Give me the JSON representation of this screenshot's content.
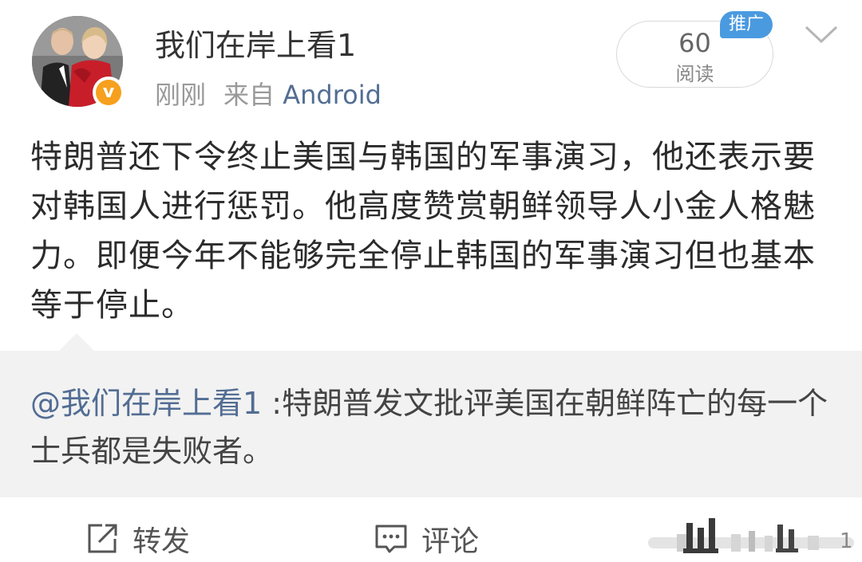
{
  "post": {
    "author": "我们在岸上看1",
    "time": "刚刚",
    "source_prefix": "来自",
    "source_device": "Android",
    "reads_count": "60",
    "reads_label": "阅读",
    "promo_badge": "推广",
    "text": "特朗普还下令终止美国与韩国的军事演习，他还表示要对韩国人进行惩罚。他高度赞赏朝鲜领导人小金人格魅力。即便今年不能够完全停止韩国的军事演习但也基本等于停止。"
  },
  "repost": {
    "mention": "@我们在岸上看1",
    "text": " :特朗普发文批评美国在朝鲜阵亡的每一个士兵都是失败者。"
  },
  "actions": {
    "repost_label": "转发",
    "comment_label": "评论",
    "like_count": "1"
  },
  "icons": {
    "verified": "verified-badge-icon",
    "chevron": "chevron-down-icon",
    "repost": "share-icon",
    "comment": "comment-icon",
    "like": "like-icon"
  },
  "colors": {
    "link": "#526d93",
    "promo": "#4a9ae0",
    "verified": "#f6a01e",
    "repost_bg": "#f2f2f2"
  }
}
